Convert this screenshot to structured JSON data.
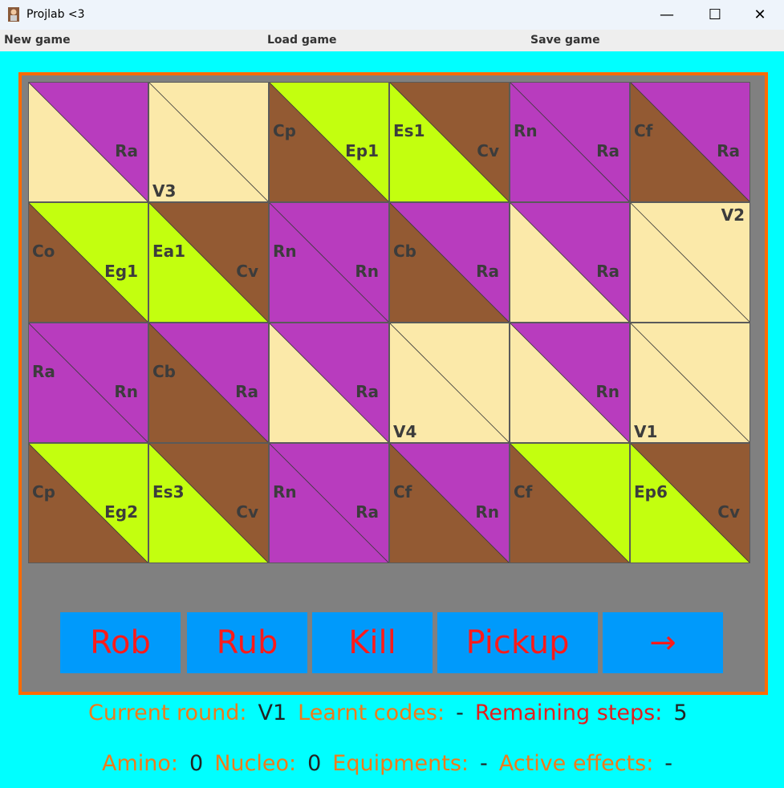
{
  "window": {
    "title": "Projlab <3",
    "minimize": "—",
    "maximize": "☐",
    "close": "✕"
  },
  "menu": {
    "new_game": "New game",
    "load_game": "Load game",
    "save_game": "Save game"
  },
  "colors": {
    "beige": "#fbe9a9",
    "purple": "#b83cbe",
    "brown": "#935a33",
    "lime": "#c3ff0f",
    "frame": "#ff6a00",
    "background": "#00ffff",
    "button": "#009afb",
    "button_text": "#ff1a1a"
  },
  "board": {
    "rows": [
      [
        {
          "a": "beige",
          "b": "purple",
          "tl": "",
          "br": "Ra",
          "bl": "",
          "tr": ""
        },
        {
          "a": "beige",
          "b": "beige",
          "tl": "",
          "br": "",
          "bl": "V3",
          "tr": ""
        },
        {
          "a": "brown",
          "b": "lime",
          "tl": "Cp",
          "br": "Ep1",
          "bl": "",
          "tr": ""
        },
        {
          "a": "lime",
          "b": "brown",
          "tl": "Es1",
          "br": "Cv",
          "bl": "",
          "tr": ""
        },
        {
          "a": "purple",
          "b": "purple",
          "tl": "Rn",
          "br": "Ra",
          "bl": "",
          "tr": ""
        },
        {
          "a": "brown",
          "b": "purple",
          "tl": "Cf",
          "br": "Ra",
          "bl": "",
          "tr": ""
        }
      ],
      [
        {
          "a": "brown",
          "b": "lime",
          "tl": "Co",
          "br": "Eg1",
          "bl": "",
          "tr": ""
        },
        {
          "a": "lime",
          "b": "brown",
          "tl": "Ea1",
          "br": "Cv",
          "bl": "",
          "tr": ""
        },
        {
          "a": "purple",
          "b": "purple",
          "tl": "Rn",
          "br": "Rn",
          "bl": "",
          "tr": ""
        },
        {
          "a": "brown",
          "b": "purple",
          "tl": "Cb",
          "br": "Ra",
          "bl": "",
          "tr": ""
        },
        {
          "a": "beige",
          "b": "purple",
          "tl": "",
          "br": "Ra",
          "bl": "",
          "tr": ""
        },
        {
          "a": "beige",
          "b": "beige",
          "tl": "",
          "br": "",
          "bl": "",
          "tr": "V2"
        }
      ],
      [
        {
          "a": "purple",
          "b": "purple",
          "tl": "Ra",
          "br": "Rn",
          "bl": "",
          "tr": ""
        },
        {
          "a": "brown",
          "b": "purple",
          "tl": "Cb",
          "br": "Ra",
          "bl": "",
          "tr": ""
        },
        {
          "a": "beige",
          "b": "purple",
          "tl": "",
          "br": "Ra",
          "bl": "",
          "tr": ""
        },
        {
          "a": "beige",
          "b": "beige",
          "tl": "",
          "br": "",
          "bl": "V4",
          "tr": ""
        },
        {
          "a": "beige",
          "b": "purple",
          "tl": "",
          "br": "Rn",
          "bl": "",
          "tr": ""
        },
        {
          "a": "beige",
          "b": "beige",
          "tl": "",
          "br": "",
          "bl": "V1",
          "tr": ""
        }
      ],
      [
        {
          "a": "brown",
          "b": "lime",
          "tl": "Cp",
          "br": "Eg2",
          "bl": "",
          "tr": ""
        },
        {
          "a": "lime",
          "b": "brown",
          "tl": "Es3",
          "br": "Cv",
          "bl": "",
          "tr": ""
        },
        {
          "a": "purple",
          "b": "purple",
          "tl": "Rn",
          "br": "Ra",
          "bl": "",
          "tr": ""
        },
        {
          "a": "brown",
          "b": "purple",
          "tl": "Cf",
          "br": "Rn",
          "bl": "",
          "tr": ""
        },
        {
          "a": "brown",
          "b": "lime",
          "tl": "Cf",
          "br": "",
          "bl": "",
          "tr": ""
        },
        {
          "a": "lime",
          "b": "brown",
          "tl": "Ep6",
          "br": "Cv",
          "bl": "",
          "tr": ""
        }
      ]
    ]
  },
  "actions": {
    "rob": "Rob",
    "rub": "Rub",
    "kill": "Kill",
    "pickup": "Pickup",
    "next": "→"
  },
  "status": {
    "current_round_label": "Current round:",
    "current_round": "V1",
    "learnt_codes_label": "Learnt codes:",
    "learnt_codes": "-",
    "remaining_steps_label": "Remaining steps:",
    "remaining_steps": "5",
    "amino_label": "Amino:",
    "amino": "0",
    "nucleo_label": "Nucleo:",
    "nucleo": "0",
    "equipments_label": "Equipments:",
    "equipments": "-",
    "active_effects_label": "Active effects:",
    "active_effects": "-"
  }
}
